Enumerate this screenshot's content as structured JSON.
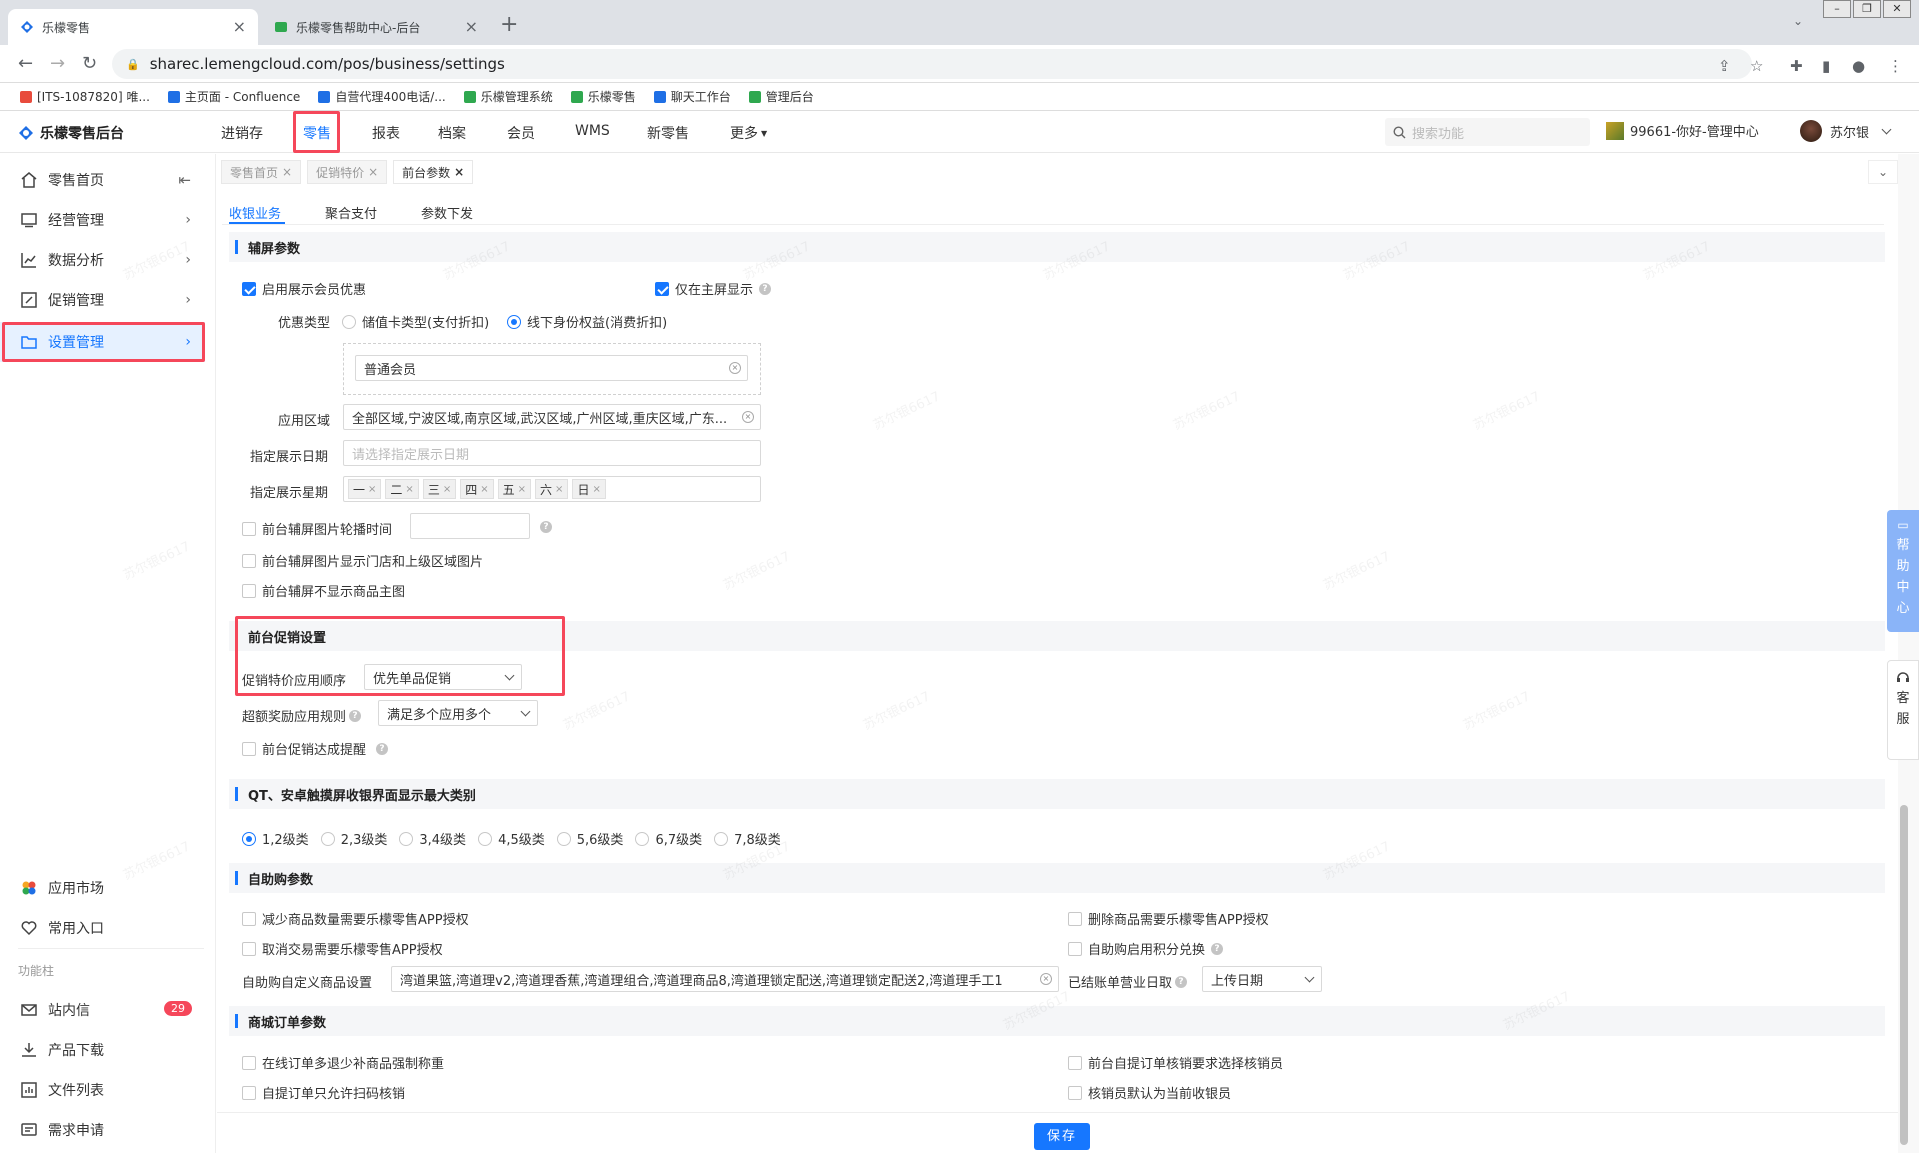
{
  "browser": {
    "tabs": [
      {
        "title": "乐檬零售",
        "close": "×"
      },
      {
        "title": "乐檬零售帮助中心-后台",
        "close": "×"
      }
    ],
    "new_tab": "+",
    "url": "sharec.lemengcloud.com/pos/business/settings",
    "bookmarks": [
      "[ITS-1087820] 唯...",
      "主页面 - Confluence",
      "自营代理400电话/...",
      "乐檬管理系统",
      "乐檬零售",
      "聊天工作台",
      "管理后台"
    ],
    "bookmark_colors": [
      "#e84b3c",
      "#1f6fe5",
      "#1f6fe5",
      "#2fa84f",
      "#2fa84f",
      "#1f6fe5",
      "#2fa84f"
    ]
  },
  "app": {
    "brand": "乐檬零售后台",
    "nav": [
      "进销存",
      "零售",
      "报表",
      "档案",
      "会员",
      "WMS",
      "新零售",
      "更多"
    ],
    "nav_active": 1,
    "search_placeholder": "搜索功能",
    "store": "99661-你好-管理中心",
    "user": "苏尔银"
  },
  "sidebar": {
    "items": [
      {
        "label": "零售首页",
        "icon": "home-icon"
      },
      {
        "label": "经营管理",
        "icon": "monitor-icon"
      },
      {
        "label": "数据分析",
        "icon": "chart-icon"
      },
      {
        "label": "促销管理",
        "icon": "promo-icon"
      },
      {
        "label": "设置管理",
        "icon": "folder-icon"
      }
    ],
    "bottom": [
      {
        "label": "应用市场",
        "icon": "app-market-icon"
      },
      {
        "label": "常用入口",
        "icon": "heart-icon"
      }
    ],
    "section_label": "功能柱",
    "tools": [
      {
        "label": "站内信",
        "icon": "mail-icon",
        "badge": "29"
      },
      {
        "label": "产品下载",
        "icon": "download-icon"
      },
      {
        "label": "文件列表",
        "icon": "file-list-icon"
      },
      {
        "label": "需求申请",
        "icon": "request-icon"
      }
    ]
  },
  "page_tabs": [
    {
      "label": "零售首页",
      "close": "×"
    },
    {
      "label": "促销特价",
      "close": "×"
    },
    {
      "label": "前台参数",
      "close": "×"
    }
  ],
  "sub_tabs": [
    "收银业务",
    "聚合支付",
    "参数下发"
  ],
  "sections": {
    "aux_screen": {
      "title": "辅屏参数",
      "show_member_discount": "启用展示会员优惠",
      "main_screen_only": "仅在主屏显示",
      "discount_type_label": "优惠类型",
      "discount_options": [
        "储值卡类型(支付折扣)",
        "线下身份权益(消费折扣)"
      ],
      "member_level": "普通会员",
      "region_label": "应用区域",
      "region_value": "全部区域,宁波区域,南京区域,武汉区域,广州区域,重庆区域,广东...",
      "date_label": "指定展示日期",
      "date_placeholder": "请选择指定展示日期",
      "week_label": "指定展示星期",
      "weekdays": [
        "一",
        "二",
        "三",
        "四",
        "五",
        "六",
        "日"
      ],
      "carousel_time": "前台辅屏图片轮播时间",
      "show_store_images": "前台辅屏图片显示门店和上级区域图片",
      "hide_main_image": "前台辅屏不显示商品主图"
    },
    "promo": {
      "title": "前台促销设置",
      "order_label": "促销特价应用顺序",
      "order_value": "优先单品促销",
      "bonus_label": "超额奖励应用规则",
      "bonus_value": "满足多个应用多个",
      "reminder": "前台促销达成提醒"
    },
    "qt": {
      "title": "QT、安卓触摸屏收银界面显示最大类别",
      "options": [
        "1,2级类",
        "2,3级类",
        "3,4级类",
        "4,5级类",
        "5,6级类",
        "6,7级类",
        "7,8级类"
      ]
    },
    "self_service": {
      "title": "自助购参数",
      "reduce_qty": "减少商品数量需要乐檬零售APP授权",
      "delete_item": "删除商品需要乐檬零售APP授权",
      "cancel_trade": "取消交易需要乐檬零售APP授权",
      "points_exchange": "自助购启用积分兑换",
      "custom_goods_label": "自助购自定义商品设置",
      "custom_goods_value": "湾道果篮,湾道理v2,湾道理香蕉,湾道理组合,湾道理商品8,湾道理锁定配送,湾道理锁定配送2,湾道理手工1",
      "settled_date_label": "已结账单营业日取",
      "settled_date_value": "上传日期"
    },
    "mall": {
      "title": "商城订单参数",
      "weigh": "在线订单多退少补商品强制称重",
      "pickup_verifier": "前台自提订单核销要求选择核销员",
      "scan_only": "自提订单只允许扫码核销",
      "default_cashier": "核销员默认为当前收银员"
    }
  },
  "save": "保存",
  "help_center": [
    "帮",
    "助",
    "中",
    "心"
  ],
  "service": [
    "客",
    "服"
  ],
  "watermark": "苏尔银6617"
}
